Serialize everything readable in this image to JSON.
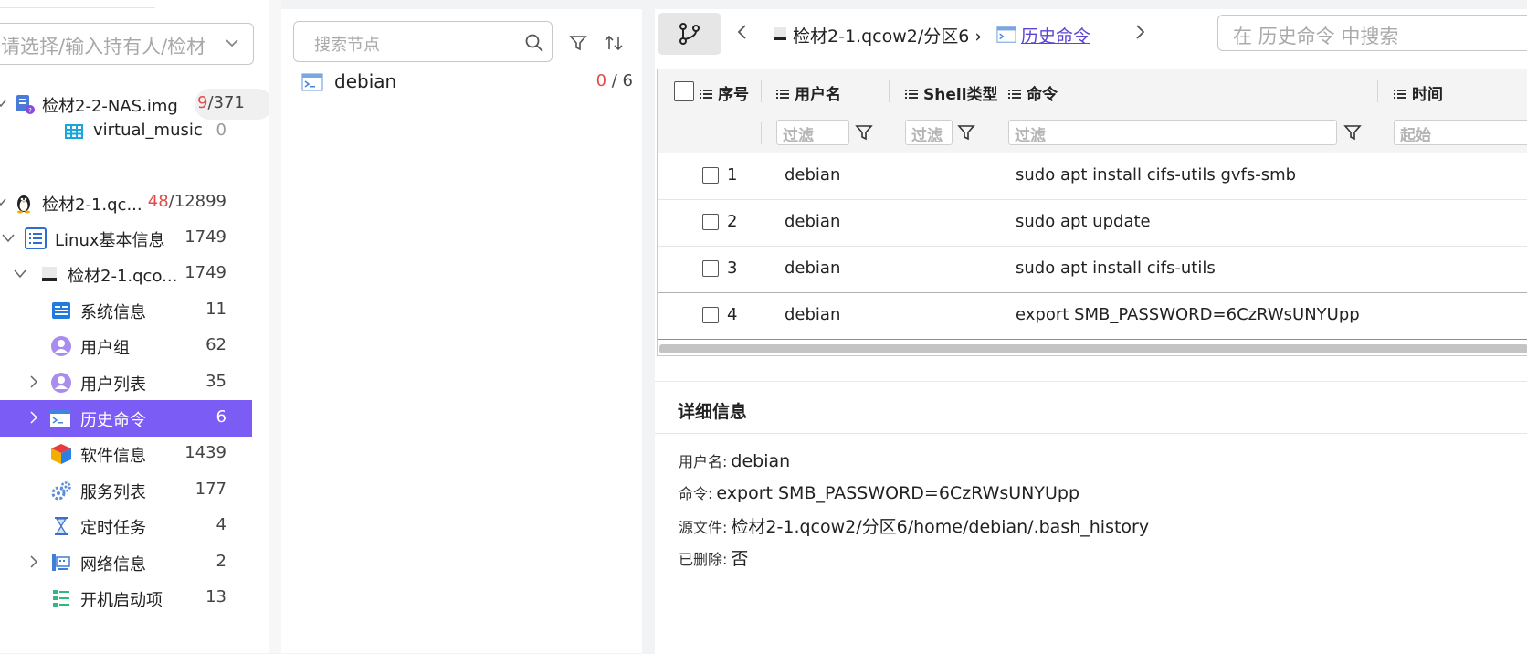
{
  "left_panel": {
    "owner_placeholder": "请选择/输入持有人/检材",
    "tree": [
      {
        "label": "检材2-2-NAS.img",
        "count_red": "9",
        "count_rest": "/371",
        "icon": "disk-image-icon"
      },
      {
        "label": "virtual_music",
        "count": "0",
        "icon": "table-icon"
      },
      {
        "label": "检材2-1.qc...",
        "count_red": "48",
        "count_rest": "/12899",
        "icon": "linux-penguin-icon"
      },
      {
        "label": "Linux基本信息",
        "count": "1749",
        "icon": "list-icon"
      },
      {
        "label": "检材2-1.qco...",
        "count": "1749",
        "icon": "drive-icon"
      },
      {
        "label": "系统信息",
        "count": "11",
        "icon": "system-info-icon"
      },
      {
        "label": "用户组",
        "count": "62",
        "icon": "user-group-icon"
      },
      {
        "label": "用户列表",
        "count": "35",
        "icon": "user-list-icon"
      },
      {
        "label": "历史命令",
        "count": "6",
        "icon": "terminal-icon"
      },
      {
        "label": "软件信息",
        "count": "1439",
        "icon": "software-cube-icon"
      },
      {
        "label": "服务列表",
        "count": "177",
        "icon": "gears-icon"
      },
      {
        "label": "定时任务",
        "count": "4",
        "icon": "hourglass-icon"
      },
      {
        "label": "网络信息",
        "count": "2",
        "icon": "network-icon"
      },
      {
        "label": "开机启动项",
        "count": "13",
        "icon": "startup-list-icon"
      }
    ]
  },
  "middle_panel": {
    "search_placeholder": "搜索节点",
    "node": {
      "label": "debian",
      "count_red": "0",
      "count_rest": " / 6"
    }
  },
  "right_panel": {
    "breadcrumb_path": "检材2-1.qcow2/分区6 ›",
    "breadcrumb_current": "历史命令",
    "search_placeholder": "在 历史命令 中搜索",
    "grid": {
      "columns": [
        "序号",
        "用户名",
        "Shell类型",
        "命令",
        "时间"
      ],
      "filter_placeholder": "过滤",
      "date_filter_placeholder": "起始",
      "rows": [
        {
          "seq": "1",
          "user": "debian",
          "command": "sudo apt install cifs-utils gvfs-smb"
        },
        {
          "seq": "2",
          "user": "debian",
          "command": "sudo apt update"
        },
        {
          "seq": "3",
          "user": "debian",
          "command": "sudo apt install cifs-utils"
        },
        {
          "seq": "4",
          "user": "debian",
          "command": "export SMB_PASSWORD=6CzRWsUNYUpp"
        }
      ]
    },
    "detail": {
      "title": "详细信息",
      "fields": [
        {
          "key": "用户名:",
          "value": "debian"
        },
        {
          "key": "命令:",
          "value": "export SMB_PASSWORD=6CzRWsUNYUpp"
        },
        {
          "key": "源文件:",
          "value": "检材2-1.qcow2/分区6/home/debian/.bash_history"
        },
        {
          "key": "已删除:",
          "value": "否"
        }
      ]
    }
  },
  "colors": {
    "selected_bg": "#7b5cf5",
    "count_red": "#e34a4a",
    "link": "#5a44d6"
  }
}
